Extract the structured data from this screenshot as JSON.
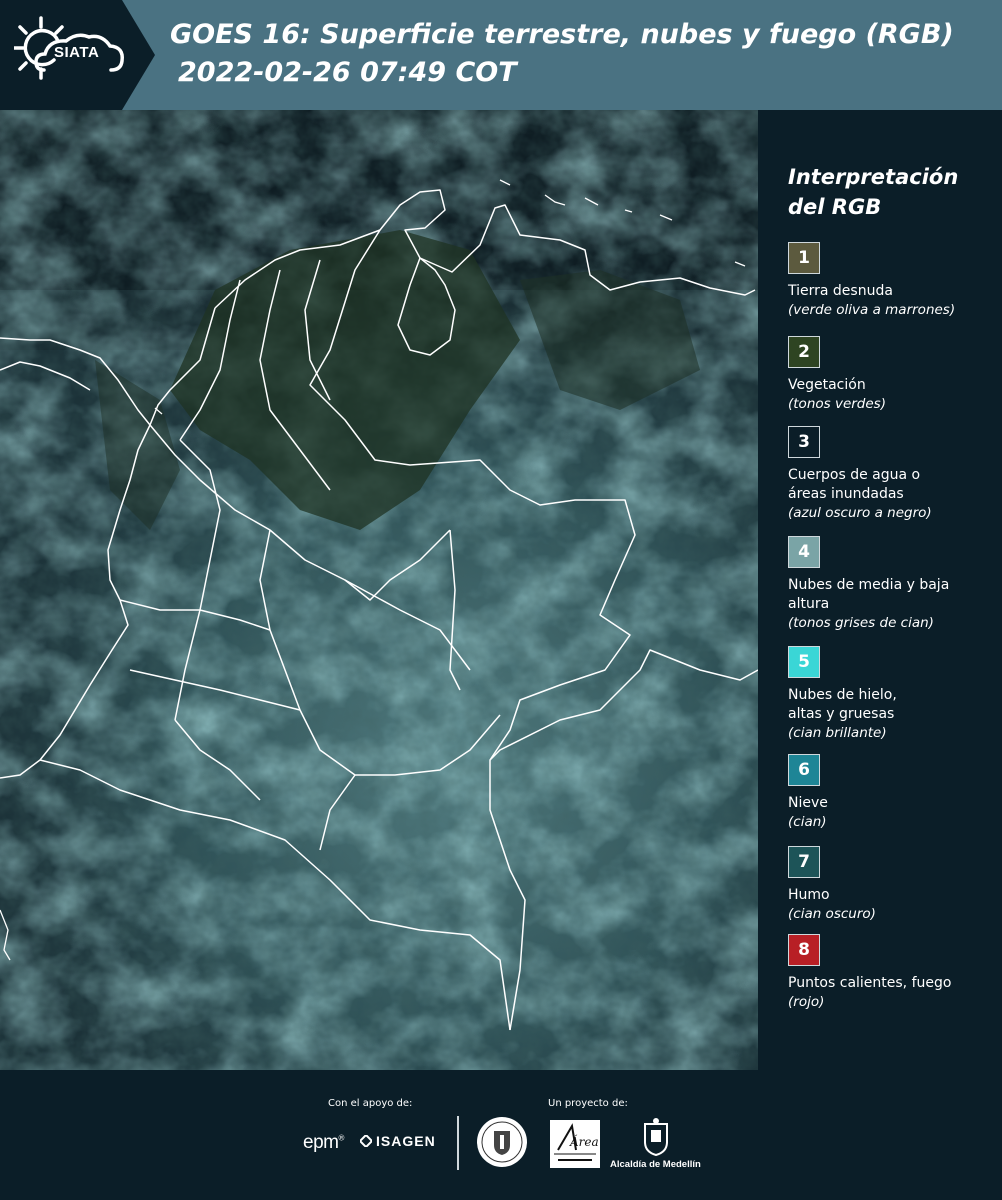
{
  "header": {
    "logo_text": "SIATA",
    "title": "GOES 16: Superficie terrestre, nubes y fuego (RGB)",
    "subtitle": "2022-02-26 07:49 COT"
  },
  "map": {
    "icon": "satellite-rgb-map"
  },
  "legend": {
    "title_line1": "Interpretación",
    "title_line2": "del RGB",
    "items": [
      {
        "number": "1",
        "color": "#5c5a3e",
        "label": "Tierra desnuda",
        "desc": "(verde oliva a marrones)"
      },
      {
        "number": "2",
        "color": "#2e4422",
        "label": "Vegetación",
        "desc": "(tonos verdes)"
      },
      {
        "number": "3",
        "color": "#0b1e28",
        "label": "Cuerpos de agua o áreas inundadas",
        "desc": "(azul oscuro a negro)"
      },
      {
        "number": "4",
        "color": "#7aa4a6",
        "label": "Nubes de media y baja altura",
        "desc": "(tonos grises de cian)"
      },
      {
        "number": "5",
        "color": "#3ad6d6",
        "label": "Nubes de hielo, altas y gruesas",
        "desc": "(cian brillante)"
      },
      {
        "number": "6",
        "color": "#1e8596",
        "label": "Nieve",
        "desc": "(cian)"
      },
      {
        "number": "7",
        "color": "#1d5458",
        "label": "Humo",
        "desc": "(cian oscuro)"
      },
      {
        "number": "8",
        "color": "#b81f25",
        "label": "Puntos calientes, fuego",
        "desc": "(rojo)"
      }
    ]
  },
  "footer": {
    "support_label": "Con el apoyo de:",
    "project_label": "Un proyecto de:",
    "sponsor_epm": "epm",
    "sponsor_isagen": "ISAGEN",
    "area_logo_text": "Área",
    "alcaldia_label": "Alcaldía de Medellín"
  }
}
